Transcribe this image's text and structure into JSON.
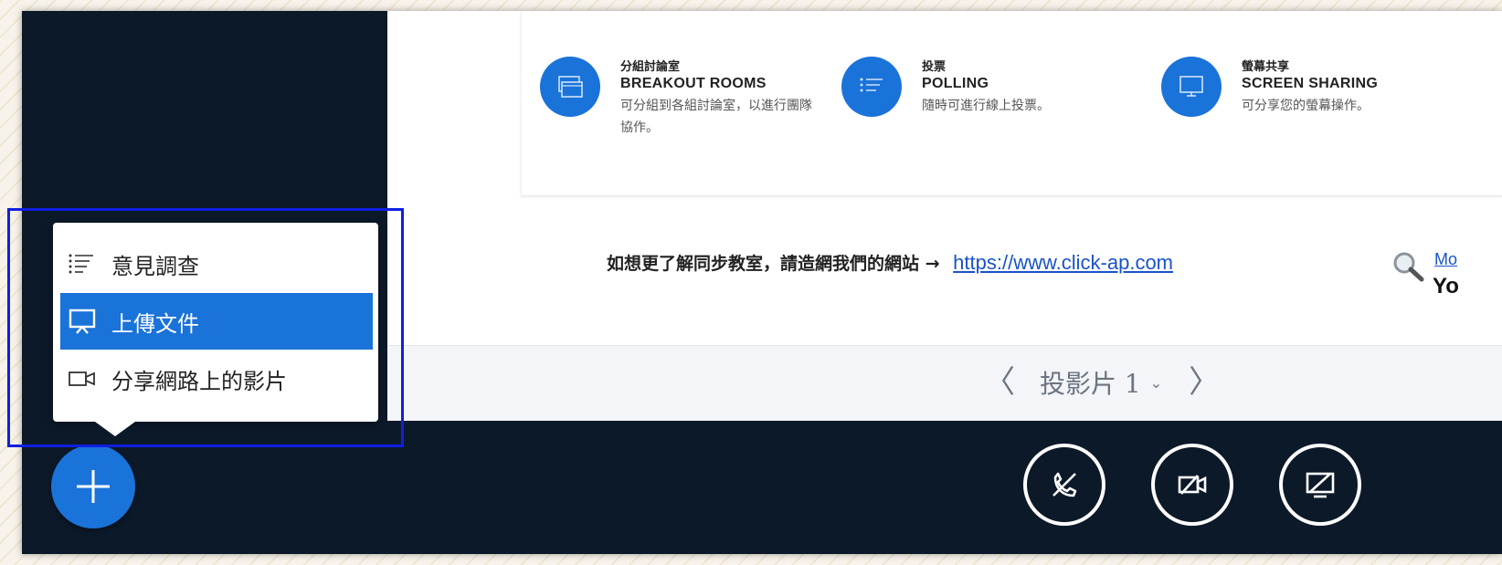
{
  "features": [
    {
      "zh": "分組討論室",
      "en": "BREAKOUT ROOMS",
      "desc": "可分組到各組討論室，以進行團隊協作。"
    },
    {
      "zh": "投票",
      "en": "POLLING",
      "desc": "隨時可進行線上投票。"
    },
    {
      "zh": "螢幕共享",
      "en": "SCREEN SHARING",
      "desc": "可分享您的螢幕操作。"
    }
  ],
  "info": {
    "text": "如想更了解同步教室，請造網我們的網站 →",
    "url": "https://www.click-ap.com"
  },
  "more": {
    "link": "Mo",
    "yo": "Yo"
  },
  "slides": {
    "prev": "〈",
    "label": "投影片 1",
    "dropdown": "⌄",
    "next": "〉"
  },
  "actions_menu": {
    "items": [
      {
        "label": "意見調查",
        "icon": "list-icon"
      },
      {
        "label": "上傳文件",
        "icon": "presentation-icon"
      },
      {
        "label": "分享網路上的影片",
        "icon": "video-icon"
      }
    ]
  },
  "colors": {
    "accent": "#1a73d8",
    "dark": "#0c1929",
    "highlight": "#0f1fe0"
  }
}
